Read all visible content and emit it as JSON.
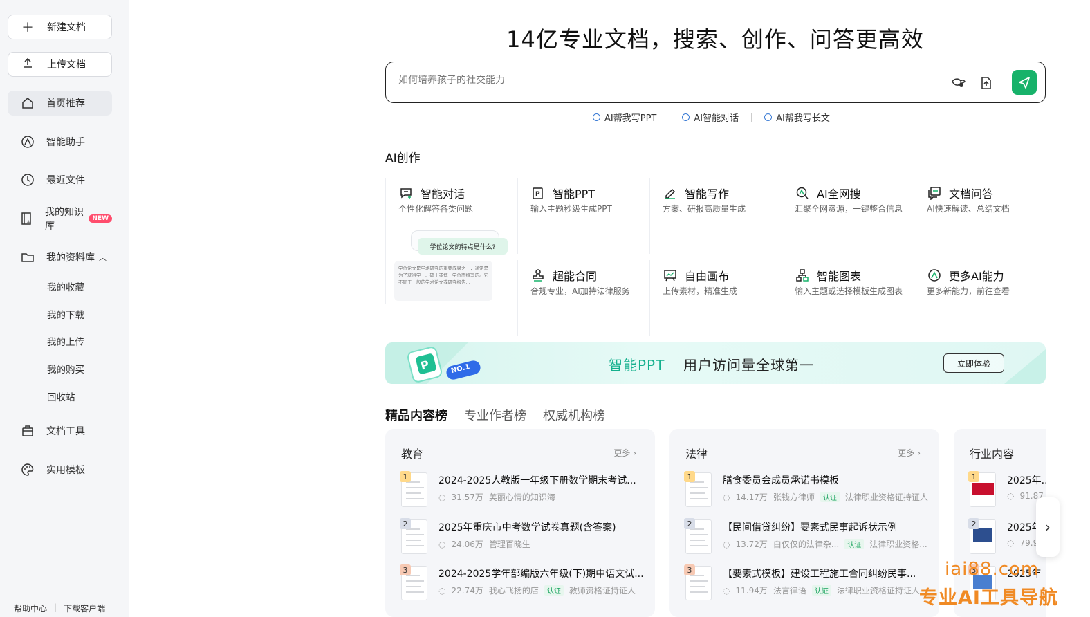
{
  "sidebar": {
    "new_doc": "新建文档",
    "upload_doc": "上传文档",
    "nav": [
      {
        "label": "首页推荐",
        "icon": "home-icon"
      },
      {
        "label": "智能助手",
        "icon": "ai-assistant-icon"
      },
      {
        "label": "最近文件",
        "icon": "clock-icon"
      },
      {
        "label": "我的知识库",
        "icon": "knowledge-base-icon",
        "badge": "NEW"
      },
      {
        "label": "我的资料库",
        "icon": "folder-icon"
      }
    ],
    "sub_items": [
      "我的收藏",
      "我的下载",
      "我的上传",
      "我的购买",
      "回收站"
    ],
    "tools": [
      {
        "label": "文档工具",
        "icon": "toolbox-icon"
      },
      {
        "label": "实用模板",
        "icon": "palette-icon"
      }
    ],
    "footer": [
      "帮助中心",
      "下载客户端"
    ]
  },
  "hero": {
    "title": "14亿专业文档，搜索、创作、问答更高效",
    "search_placeholder": "如何培养孩子的社交能力",
    "quick_links": [
      "AI帮我写PPT",
      "AI智能对话",
      "AI帮我写长文"
    ]
  },
  "ai_creation": {
    "title": "AI创作",
    "cards": [
      {
        "title": "智能对话",
        "desc": "个性化解答各类问题",
        "icon": "chat-plus-icon"
      },
      {
        "title": "智能PPT",
        "desc": "输入主题秒级生成PPT",
        "icon": "ppt-icon"
      },
      {
        "title": "智能写作",
        "desc": "方案、研报高质量生成",
        "icon": "pen-icon"
      },
      {
        "title": "AI全网搜",
        "desc": "汇聚全网资源，一键整合信息",
        "icon": "web-search-icon"
      },
      {
        "title": "文档问答",
        "desc": "AI快速解读、总结文档",
        "icon": "doc-chat-icon"
      },
      {
        "title": "超能合同",
        "desc": "合规专业，AI加持法律服务",
        "icon": "stamp-icon"
      },
      {
        "title": "自由画布",
        "desc": "上传素材，精准生成",
        "icon": "canvas-icon"
      },
      {
        "title": "智能图表",
        "desc": "输入主题或选择模板生成图表",
        "icon": "chart-tree-icon"
      },
      {
        "title": "更多AI能力",
        "desc": "更多新能力，前往查看",
        "icon": "more-ai-icon"
      }
    ],
    "preview": {
      "question": "学位论文的特点是什么?",
      "answer": "学位论文是学术研究的重要成果之一，通常是为了获得学士、硕士或博士学位而撰写的。它不同于一般的学术论文或研究报告..."
    }
  },
  "banner": {
    "badge": "NO.1",
    "highlight": "智能PPT",
    "text": "用户访问量全球第一",
    "button": "立即体验"
  },
  "rank_tabs": [
    "精品内容榜",
    "专业作者榜",
    "权威机构榜"
  ],
  "panels": [
    {
      "title": "教育",
      "more": "更多",
      "items": [
        {
          "rank": "1",
          "title": "2024-2025人教版一年级下册数学期末考试...",
          "views": "31.57万",
          "author": "美丽心情的知识海",
          "auth": "",
          "cert": ""
        },
        {
          "rank": "2",
          "title": "2025年重庆市中考数学试卷真题(含答案)",
          "views": "24.06万",
          "author": "管理百晓生",
          "auth": "",
          "cert": ""
        },
        {
          "rank": "3",
          "title": "2024-2025学年部编版六年级(下)期中语文试...",
          "views": "22.74万",
          "author": "我心飞扬的店",
          "auth": "认证",
          "cert": "教师资格证持证人"
        }
      ]
    },
    {
      "title": "法律",
      "more": "更多",
      "items": [
        {
          "rank": "1",
          "title": "膳食委员会成员承诺书模板",
          "views": "14.17万",
          "author": "张钱方律师",
          "auth": "认证",
          "cert": "法律职业资格证持证人"
        },
        {
          "rank": "2",
          "title": "【民间借贷纠纷】要素式民事起诉状示例",
          "views": "13.72万",
          "author": "白仅仅的法律杂...",
          "auth": "认证",
          "cert": "法律职业资格..."
        },
        {
          "rank": "3",
          "title": "【要素式模板】建设工程施工合同纠纷民事...",
          "views": "11.94万",
          "author": "法言律语",
          "auth": "认证",
          "cert": "法律职业资格证持证人"
        }
      ]
    },
    {
      "title": "行业内容",
      "more": "",
      "items": [
        {
          "rank": "1",
          "title": "2025年...",
          "views": "91.87",
          "author": "",
          "auth": "",
          "cert": ""
        },
        {
          "rank": "2",
          "title": "2025年",
          "views": "79.9",
          "author": "",
          "auth": "",
          "cert": ""
        },
        {
          "rank": "3",
          "title": "2025年",
          "views": "",
          "author": "",
          "auth": "",
          "cert": ""
        }
      ]
    }
  ],
  "watermark": {
    "line1": "iai88.com",
    "line2": "专业AI工具导航"
  },
  "colors": {
    "accent": "#17b26a",
    "banner_green": "#14b08d",
    "watermark": "#f08a24"
  }
}
